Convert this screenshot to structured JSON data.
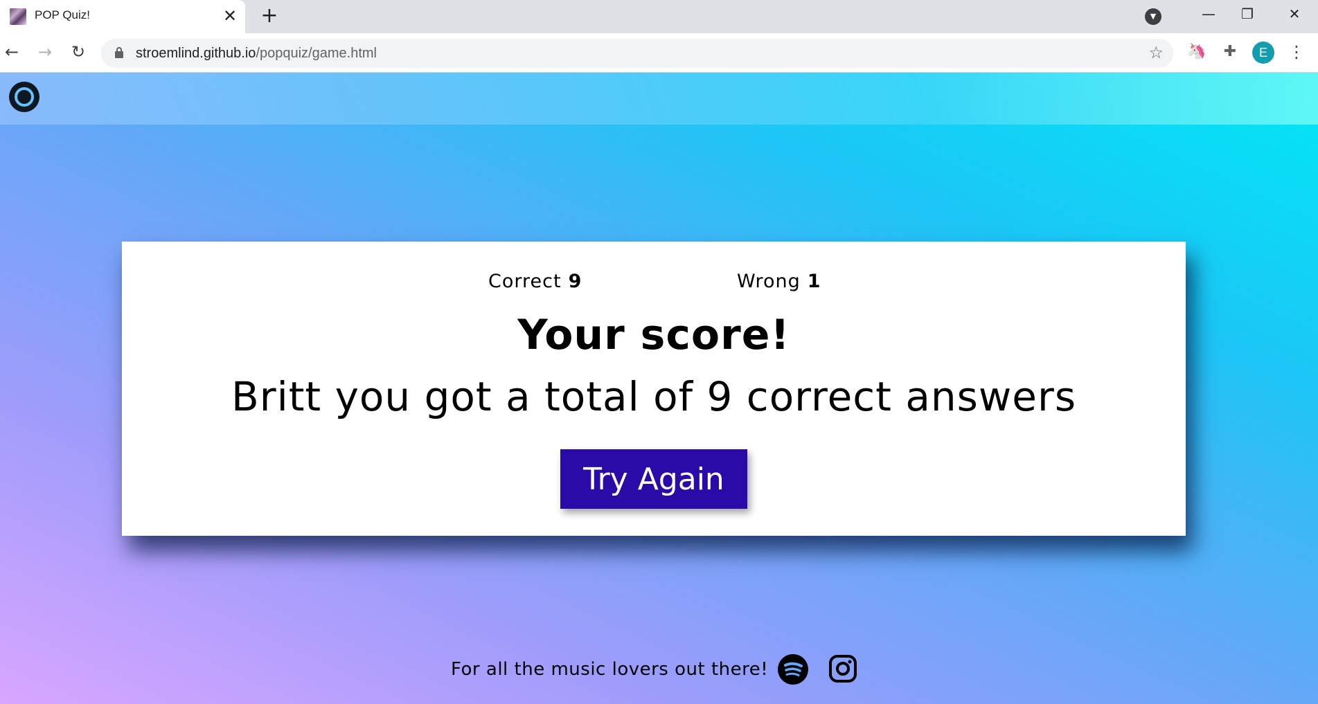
{
  "browser": {
    "tab_title": "POP Quiz!",
    "tab_close": "✕",
    "new_tab": "+",
    "url_host": "stroemlind.github.io",
    "url_path": "/popquiz/game.html",
    "profile_initial": "E"
  },
  "page": {
    "stats": {
      "correct_label": "Correct",
      "correct_value": "9",
      "wrong_label": "Wrong",
      "wrong_value": "1"
    },
    "score_title": "Your score!",
    "score_message": "Britt you got a total of 9 correct answers",
    "try_again_label": "Try Again",
    "footer_text": "For all the music lovers out there!"
  },
  "icons": {
    "logo": "vinyl-record-icon",
    "social": [
      "spotify-icon",
      "instagram-icon"
    ]
  },
  "colors": {
    "button_bg": "#2b0ba8",
    "card_bg": "#ffffff"
  }
}
